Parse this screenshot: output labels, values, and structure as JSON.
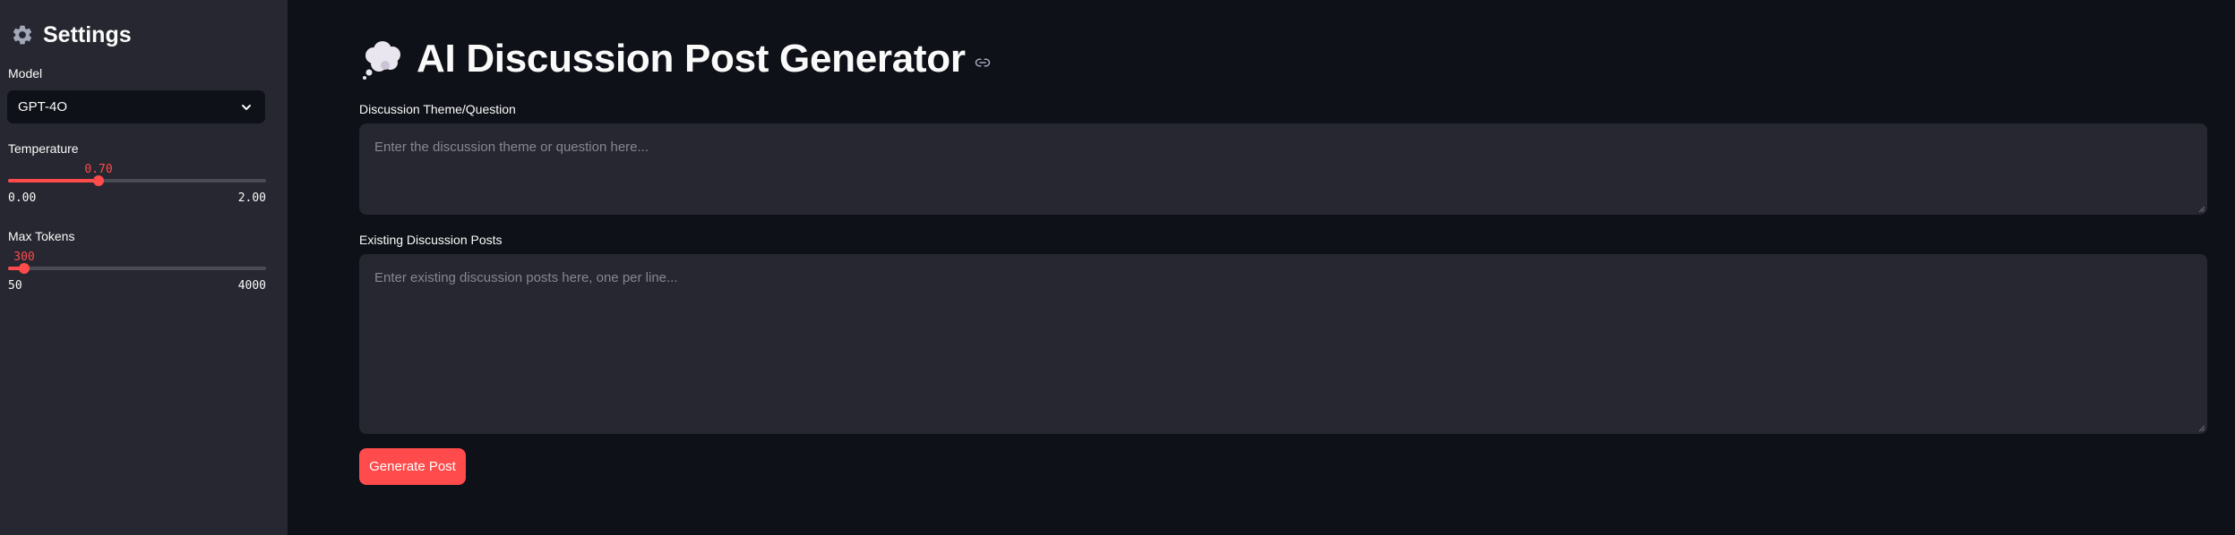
{
  "sidebar": {
    "title": "Settings",
    "title_icon": "gear-icon",
    "model": {
      "label": "Model",
      "value": "GPT-4O",
      "icon": "chevron-down-icon"
    },
    "temperature": {
      "label": "Temperature",
      "value": "0.70",
      "min": "0.00",
      "max": "2.00",
      "fraction": 0.35
    },
    "max_tokens": {
      "label": "Max Tokens",
      "value": "300",
      "min": "50",
      "max": "4000",
      "fraction": 0.063
    }
  },
  "main": {
    "title": "AI Discussion Post Generator",
    "title_icon": "thought-balloon-icon",
    "anchor_icon": "link-icon",
    "theme_field": {
      "label": "Discussion Theme/Question",
      "placeholder": "Enter the discussion theme or question here...",
      "value": ""
    },
    "posts_field": {
      "label": "Existing Discussion Posts",
      "placeholder": "Enter existing discussion posts here, one per line...",
      "value": ""
    },
    "generate_button": "Generate Post"
  },
  "colors": {
    "accent": "#ff4b4b",
    "background": "#0e1117",
    "sidebar": "#262730",
    "input": "#262730"
  }
}
